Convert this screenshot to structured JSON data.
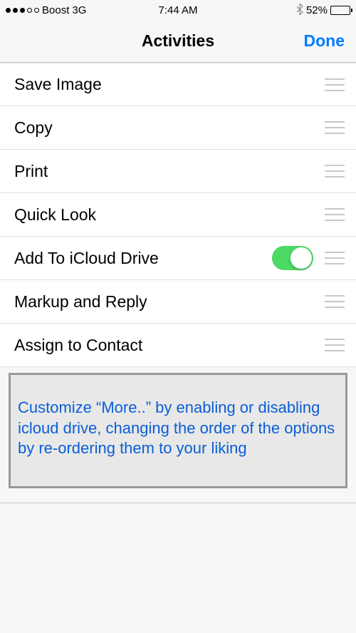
{
  "status_bar": {
    "carrier": "Boost",
    "network": "3G",
    "time": "7:44 AM",
    "battery_percent": "52%"
  },
  "nav": {
    "title": "Activities",
    "done": "Done"
  },
  "rows": [
    {
      "label": "Save Image",
      "has_switch": false
    },
    {
      "label": "Copy",
      "has_switch": false
    },
    {
      "label": "Print",
      "has_switch": false
    },
    {
      "label": "Quick Look",
      "has_switch": false
    },
    {
      "label": "Add To iCloud Drive",
      "has_switch": true,
      "switch_on": true
    },
    {
      "label": "Markup and Reply",
      "has_switch": false
    },
    {
      "label": "Assign to Contact",
      "has_switch": false
    }
  ],
  "callout": {
    "text": "Customize “More..” by enabling or disabling icloud drive, changing the order of the options by re-ordering them to your liking"
  },
  "colors": {
    "accent": "#007aff",
    "switch_on": "#4cd964"
  }
}
